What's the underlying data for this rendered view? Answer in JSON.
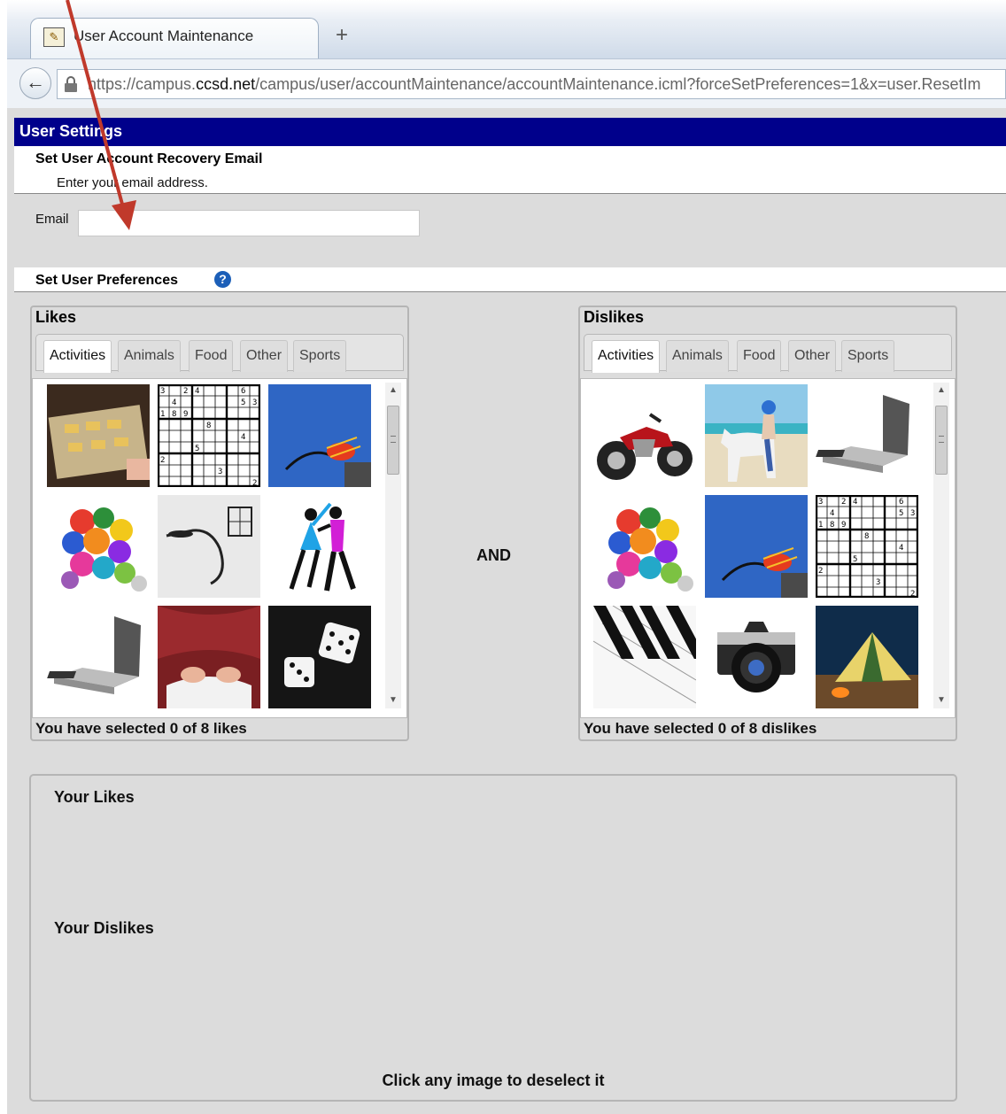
{
  "browser": {
    "tab_title": "User Account Maintenance",
    "new_tab": "+",
    "url_prefix": "https://campus.",
    "url_domain": "ccsd.net",
    "url_path": "/campus/user/accountMaintenance/accountMaintenance.icml?forceSetPreferences=1&x=user.ResetIm"
  },
  "settings": {
    "title": "User Settings",
    "recovery_heading": "Set User Account Recovery Email",
    "recovery_desc": "Enter your email address.",
    "email_label": "Email",
    "email_value": "",
    "prefs_heading": "Set User Preferences"
  },
  "likes": {
    "title": "Likes",
    "tabs": [
      "Activities",
      "Animals",
      "Food",
      "Other",
      "Sports"
    ],
    "active_tab": "Activities",
    "images": [
      "baking-cookies",
      "sudoku",
      "fishing-fly",
      "puzzle-pieces",
      "fishing-lure",
      "dancing-couple",
      "laptop",
      "reading-book",
      "dice"
    ],
    "footer": "You have selected 0 of 8 likes"
  },
  "dislikes": {
    "title": "Dislikes",
    "tabs": [
      "Activities",
      "Animals",
      "Food",
      "Other",
      "Sports"
    ],
    "active_tab": "Activities",
    "images": [
      "motorcycle",
      "horse-riding",
      "laptop",
      "puzzle-pieces",
      "fishing-fly",
      "sudoku",
      "piano-keys",
      "camera",
      "camping-tent"
    ],
    "footer": "You have selected 0 of 8 dislikes"
  },
  "and_label": "AND",
  "summary": {
    "likes_heading": "Your Likes",
    "dislikes_heading": "Your Dislikes",
    "hint": "Click any image to deselect it"
  },
  "colors": {
    "header_bar": "#00008b",
    "page_bg": "#dcdcdc",
    "annotation_arrow": "#c0392b"
  }
}
